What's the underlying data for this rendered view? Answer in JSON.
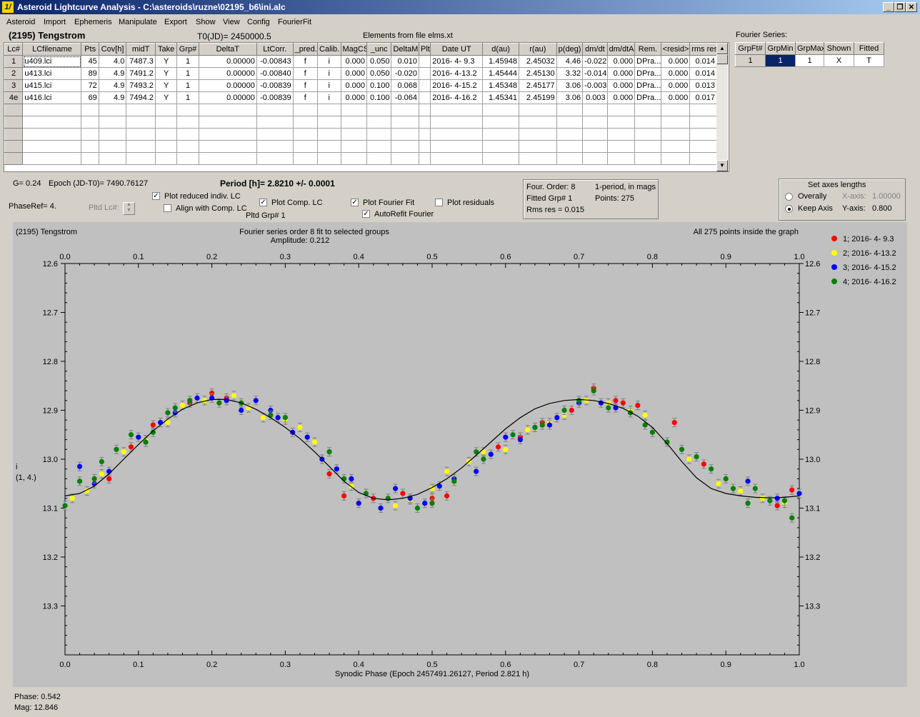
{
  "window": {
    "icon_glyph": "1/",
    "title": "Asteroid Lightcurve Analysis - C:\\asteroids\\ruzne\\02195_b6\\ini.alc",
    "btn_min": "_",
    "btn_restore": "❐",
    "btn_close": "✕"
  },
  "menu": [
    "Asteroid",
    "Import",
    "Ephemeris",
    "Manipulate",
    "Export",
    "Show",
    "View",
    "Config",
    "FourierFit"
  ],
  "header": {
    "asteroid": "(2195) Tengstrom",
    "t0": "T0(JD)= 2450000.5",
    "elements": "Elements from file elms.xt"
  },
  "table": {
    "columns": [
      "Lc#",
      "LCfilename",
      "Pts",
      "Cov[h]",
      "midT",
      "Take",
      "Grp#",
      "DeltaT",
      "LtCorr.",
      "_pred.",
      "Calib.",
      "MagCS",
      "_unc",
      "DeltaM",
      "Plt",
      "Date UT",
      "d(au)",
      "r(au)",
      "p(deg)",
      "dm/dt",
      "dm/dtA",
      "Rem.",
      "<resid>",
      "rms res"
    ],
    "rows": [
      [
        "1",
        "u409.lci",
        "45",
        "4.0",
        "7487.3",
        "Y",
        "1",
        "0.00000",
        "-0.00843",
        "f",
        "i",
        "0.000",
        "0.050",
        "0.010",
        "",
        "2016- 4- 9.3",
        "1.45948",
        "2.45032",
        "4.46",
        "-0.022",
        "0.000",
        "DPra...",
        "0.000",
        "0.014"
      ],
      [
        "2",
        "u413.lci",
        "89",
        "4.9",
        "7491.2",
        "Y",
        "1",
        "0.00000",
        "-0.00840",
        "f",
        "i",
        "0.000",
        "0.050",
        "-0.020",
        "",
        "2016- 4-13.2",
        "1.45444",
        "2.45130",
        "3.32",
        "-0.014",
        "0.000",
        "DPra...",
        "0.000",
        "0.014"
      ],
      [
        "3",
        "u415.lci",
        "72",
        "4.9",
        "7493.2",
        "Y",
        "1",
        "0.00000",
        "-0.00839",
        "f",
        "i",
        "0.000",
        "0.100",
        "0.068",
        "",
        "2016- 4-15.2",
        "1.45348",
        "2.45177",
        "3.06",
        "-0.003",
        "0.000",
        "DPra...",
        "0.000",
        "0.013"
      ],
      [
        "4e",
        "u416.lci",
        "69",
        "4.9",
        "7494.2",
        "Y",
        "1",
        "0.00000",
        "-0.00839",
        "f",
        "i",
        "0.000",
        "0.100",
        "-0.064",
        "",
        "2016- 4-16.2",
        "1.45341",
        "2.45199",
        "3.06",
        "0.003",
        "0.000",
        "DPra...",
        "0.000",
        "0.017"
      ]
    ],
    "empty_rows": 5
  },
  "fourier_series": {
    "label": "Fourier Series:",
    "columns": [
      "GrpFt#",
      "GrpMin",
      "GrpMax",
      "Shown",
      "Fitted"
    ],
    "row": [
      "1",
      "1",
      "1",
      "X",
      "T"
    ]
  },
  "params": {
    "g": "G= 0.24",
    "epoch": "Epoch (JD-T0)= 7490.76127",
    "period": "Period [h]= 2.8210 +/- 0.0001",
    "phase_ref": "PhaseRef= 4.",
    "pltd_lc": "Pltd Lc#:",
    "pltd_grp": "Pltd Grp#  1"
  },
  "checkboxes": {
    "plot_reduced": {
      "label": "Plot reduced indiv. LC",
      "checked": true
    },
    "align_comp": {
      "label": "Align with Comp. LC",
      "checked": false
    },
    "plot_comp": {
      "label": "Plot Comp. LC",
      "checked": true
    },
    "plot_fourier": {
      "label": "Plot Fourier Fit",
      "checked": true
    },
    "autorefit": {
      "label": "AutoRefit Fourier",
      "checked": true
    },
    "plot_residuals": {
      "label": "Plot residuals",
      "checked": false
    }
  },
  "fourier_info": {
    "order": "Four. Order:  8",
    "period_mode": "1-period, in mags",
    "fitted_grp": "Fitted Grp# 1",
    "points": "Points: 275",
    "rms": "Rms res     = 0.015"
  },
  "axes_box": {
    "title": "Set axes lengths",
    "overally": "Overally",
    "keep_axis": "Keep Axis",
    "selected": "keep_axis",
    "x_label": "X-axis:",
    "x_value": "1.00000",
    "y_label": "Y-axis:",
    "y_value": "0.800"
  },
  "plot_header": {
    "left": "(2195) Tengstrom",
    "center1": "Fourier series order 8 fit to selected groups",
    "center2": "Amplitude: 0.212",
    "right": "All 275 points inside the graph"
  },
  "chart_data": {
    "type": "scatter",
    "title": "Fourier series order 8 fit to selected groups",
    "subtitle": "Amplitude: 0.212",
    "xlabel": "Synodic Phase (Epoch 2457491.26127, Period 2.821 h)",
    "ylabel_lines": [
      "i",
      "(1, 4.)"
    ],
    "xlim": [
      0.0,
      1.0
    ],
    "ylim": [
      13.4,
      12.6
    ],
    "y_inverted": true,
    "xticks": [
      "0.0",
      "0.1",
      "0.2",
      "0.3",
      "0.4",
      "0.5",
      "0.6",
      "0.7",
      "0.8",
      "0.9",
      "1.0"
    ],
    "yticks": [
      "12.6",
      "12.7",
      "12.8",
      "12.9",
      "13.0",
      "13.1",
      "13.2",
      "13.3"
    ],
    "legend": [
      {
        "name": "1; 2016- 4- 9.3",
        "color": "#ff0000"
      },
      {
        "name": "2; 2016- 4-13.2",
        "color": "#ffff00"
      },
      {
        "name": "3; 2016- 4-15.2",
        "color": "#0000ff"
      },
      {
        "name": "4; 2016- 4-16.2",
        "color": "#008000"
      }
    ],
    "legend_position": "right",
    "fourier_fit": {
      "x": [
        0.0,
        0.02,
        0.04,
        0.06,
        0.08,
        0.1,
        0.12,
        0.14,
        0.16,
        0.18,
        0.2,
        0.22,
        0.24,
        0.26,
        0.28,
        0.3,
        0.32,
        0.34,
        0.36,
        0.38,
        0.4,
        0.42,
        0.44,
        0.46,
        0.48,
        0.5,
        0.52,
        0.54,
        0.56,
        0.58,
        0.6,
        0.62,
        0.64,
        0.66,
        0.68,
        0.7,
        0.72,
        0.74,
        0.76,
        0.78,
        0.8,
        0.82,
        0.84,
        0.86,
        0.88,
        0.9,
        0.92,
        0.94,
        0.96,
        0.98,
        1.0
      ],
      "y": [
        13.075,
        13.07,
        13.055,
        13.03,
        13.0,
        12.97,
        12.942,
        12.918,
        12.898,
        12.885,
        12.878,
        12.878,
        12.885,
        12.898,
        12.915,
        12.935,
        12.958,
        12.985,
        13.015,
        13.045,
        13.068,
        13.08,
        13.083,
        13.08,
        13.072,
        13.058,
        13.04,
        13.018,
        12.992,
        12.965,
        12.938,
        12.915,
        12.897,
        12.886,
        12.88,
        12.878,
        12.88,
        12.886,
        12.896,
        12.912,
        12.935,
        12.968,
        13.005,
        13.038,
        13.06,
        13.07,
        13.075,
        13.078,
        13.079,
        13.078,
        13.075
      ]
    },
    "series": [
      {
        "name": "1; 2016- 4- 9.3",
        "color": "#ff0000",
        "points": [
          [
            0.06,
            13.04
          ],
          [
            0.09,
            12.975
          ],
          [
            0.12,
            12.93
          ],
          [
            0.17,
            12.885
          ],
          [
            0.2,
            12.865
          ],
          [
            0.22,
            12.875
          ],
          [
            0.36,
            13.03
          ],
          [
            0.38,
            13.075
          ],
          [
            0.42,
            13.08
          ],
          [
            0.46,
            13.07
          ],
          [
            0.5,
            13.08
          ],
          [
            0.52,
            13.075
          ],
          [
            0.59,
            12.975
          ],
          [
            0.62,
            12.955
          ],
          [
            0.65,
            12.925
          ],
          [
            0.69,
            12.9
          ],
          [
            0.72,
            12.855
          ],
          [
            0.75,
            12.88
          ],
          [
            0.76,
            12.885
          ],
          [
            0.78,
            12.89
          ],
          [
            0.83,
            12.925
          ],
          [
            0.87,
            13.01
          ],
          [
            0.97,
            13.095
          ],
          [
            0.99,
            13.063
          ]
        ]
      },
      {
        "name": "2; 2016- 4-13.2",
        "color": "#ffff00",
        "points": [
          [
            0.01,
            13.08
          ],
          [
            0.03,
            13.065
          ],
          [
            0.05,
            13.03
          ],
          [
            0.08,
            12.985
          ],
          [
            0.11,
            12.96
          ],
          [
            0.14,
            12.925
          ],
          [
            0.16,
            12.89
          ],
          [
            0.19,
            12.88
          ],
          [
            0.23,
            12.87
          ],
          [
            0.25,
            12.895
          ],
          [
            0.27,
            12.915
          ],
          [
            0.3,
            12.92
          ],
          [
            0.32,
            12.935
          ],
          [
            0.34,
            12.965
          ],
          [
            0.39,
            13.055
          ],
          [
            0.41,
            13.07
          ],
          [
            0.45,
            13.095
          ],
          [
            0.47,
            13.083
          ],
          [
            0.5,
            13.06
          ],
          [
            0.52,
            13.025
          ],
          [
            0.55,
            13.005
          ],
          [
            0.57,
            12.985
          ],
          [
            0.6,
            12.98
          ],
          [
            0.63,
            12.94
          ],
          [
            0.66,
            12.925
          ],
          [
            0.68,
            12.91
          ],
          [
            0.71,
            12.88
          ],
          [
            0.74,
            12.885
          ],
          [
            0.77,
            12.9
          ],
          [
            0.79,
            12.91
          ],
          [
            0.85,
            13.0
          ],
          [
            0.89,
            13.05
          ],
          [
            0.92,
            13.065
          ],
          [
            0.95,
            13.08
          ],
          [
            0.98,
            13.09
          ]
        ]
      },
      {
        "name": "3; 2016- 4-15.2",
        "color": "#0000ff",
        "points": [
          [
            0.02,
            13.015
          ],
          [
            0.04,
            13.05
          ],
          [
            0.06,
            13.025
          ],
          [
            0.1,
            12.955
          ],
          [
            0.13,
            12.925
          ],
          [
            0.15,
            12.905
          ],
          [
            0.18,
            12.875
          ],
          [
            0.2,
            12.875
          ],
          [
            0.22,
            12.88
          ],
          [
            0.24,
            12.9
          ],
          [
            0.26,
            12.88
          ],
          [
            0.28,
            12.9
          ],
          [
            0.29,
            12.915
          ],
          [
            0.31,
            12.945
          ],
          [
            0.33,
            12.955
          ],
          [
            0.35,
            13.0
          ],
          [
            0.37,
            13.02
          ],
          [
            0.39,
            13.04
          ],
          [
            0.4,
            13.09
          ],
          [
            0.43,
            13.1
          ],
          [
            0.45,
            13.06
          ],
          [
            0.47,
            13.08
          ],
          [
            0.49,
            13.09
          ],
          [
            0.51,
            13.055
          ],
          [
            0.53,
            13.04
          ],
          [
            0.56,
            13.025
          ],
          [
            0.58,
            12.99
          ],
          [
            0.6,
            12.955
          ],
          [
            0.62,
            12.96
          ],
          [
            0.64,
            12.935
          ],
          [
            0.66,
            12.93
          ],
          [
            0.67,
            12.915
          ],
          [
            0.7,
            12.885
          ],
          [
            0.73,
            12.885
          ],
          [
            0.75,
            12.895
          ],
          [
            0.93,
            13.045
          ],
          [
            0.97,
            13.08
          ],
          [
            1.0,
            13.07
          ]
        ]
      },
      {
        "name": "4; 2016- 4-16.2",
        "color": "#008000",
        "points": [
          [
            0.0,
            13.095
          ],
          [
            0.02,
            13.045
          ],
          [
            0.04,
            13.04
          ],
          [
            0.05,
            13.005
          ],
          [
            0.07,
            12.98
          ],
          [
            0.09,
            12.95
          ],
          [
            0.11,
            12.965
          ],
          [
            0.12,
            12.945
          ],
          [
            0.14,
            12.905
          ],
          [
            0.15,
            12.895
          ],
          [
            0.17,
            12.88
          ],
          [
            0.21,
            12.885
          ],
          [
            0.24,
            12.885
          ],
          [
            0.28,
            12.91
          ],
          [
            0.3,
            12.915
          ],
          [
            0.36,
            12.985
          ],
          [
            0.38,
            13.04
          ],
          [
            0.41,
            13.07
          ],
          [
            0.44,
            13.08
          ],
          [
            0.48,
            13.1
          ],
          [
            0.5,
            13.09
          ],
          [
            0.53,
            13.045
          ],
          [
            0.56,
            12.985
          ],
          [
            0.57,
            13.0
          ],
          [
            0.61,
            12.95
          ],
          [
            0.64,
            12.935
          ],
          [
            0.65,
            12.93
          ],
          [
            0.68,
            12.9
          ],
          [
            0.7,
            12.88
          ],
          [
            0.72,
            12.86
          ],
          [
            0.74,
            12.895
          ],
          [
            0.77,
            12.905
          ],
          [
            0.79,
            12.93
          ],
          [
            0.8,
            12.945
          ],
          [
            0.82,
            12.965
          ],
          [
            0.84,
            12.98
          ],
          [
            0.86,
            12.995
          ],
          [
            0.88,
            13.02
          ],
          [
            0.9,
            13.04
          ],
          [
            0.91,
            13.06
          ],
          [
            0.93,
            13.09
          ],
          [
            0.94,
            13.06
          ],
          [
            0.96,
            13.085
          ],
          [
            0.98,
            13.085
          ],
          [
            0.99,
            13.12
          ]
        ]
      }
    ]
  },
  "status": {
    "phase": "Phase:  0.542",
    "mag": "Mag:    12.846"
  }
}
